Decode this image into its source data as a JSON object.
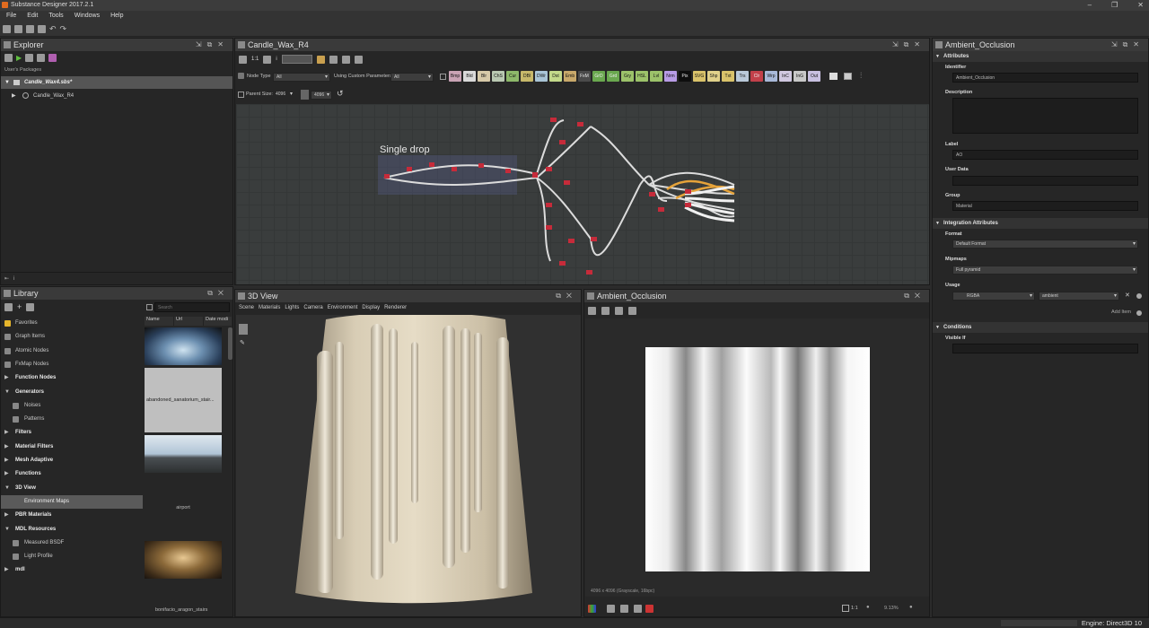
{
  "app": {
    "title": "Substance Designer 2017.2.1"
  },
  "menu": [
    "File",
    "Edit",
    "Tools",
    "Windows",
    "Help"
  ],
  "explorer": {
    "title": "Explorer",
    "section_label": "User's Packages",
    "package": "Candle_Wax4.sbs*",
    "graph": "Candle_Wax_R4"
  },
  "library": {
    "title": "Library",
    "search_placeholder": "Search",
    "columns": [
      "Name",
      "Url",
      "Date modi"
    ],
    "categories": [
      {
        "label": "Favorites",
        "bold": false,
        "type": "icon"
      },
      {
        "label": "Graph Items",
        "bold": false,
        "type": "icon"
      },
      {
        "label": "Atomic Nodes",
        "bold": false,
        "type": "icon"
      },
      {
        "label": "FxMap Nodes",
        "bold": false,
        "type": "icon"
      },
      {
        "label": "Function Nodes",
        "bold": true,
        "type": "collapsed"
      },
      {
        "label": "Generators",
        "bold": true,
        "type": "expanded"
      },
      {
        "label": "Noises",
        "bold": false,
        "type": "child"
      },
      {
        "label": "Patterns",
        "bold": false,
        "type": "child"
      },
      {
        "label": "Filters",
        "bold": true,
        "type": "collapsed"
      },
      {
        "label": "Material Filters",
        "bold": true,
        "type": "collapsed"
      },
      {
        "label": "Mesh Adaptive",
        "bold": true,
        "type": "collapsed"
      },
      {
        "label": "Functions",
        "bold": true,
        "type": "collapsed"
      },
      {
        "label": "3D View",
        "bold": true,
        "type": "expanded"
      },
      {
        "label": "Environment Maps",
        "bold": false,
        "type": "selected"
      },
      {
        "label": "PBR Materials",
        "bold": true,
        "type": "collapsed"
      },
      {
        "label": "MDL Resources",
        "bold": true,
        "type": "expanded"
      },
      {
        "label": "Measured BSDF",
        "bold": false,
        "type": "child"
      },
      {
        "label": "Light Profile",
        "bold": false,
        "type": "child"
      },
      {
        "label": "mdl",
        "bold": true,
        "type": "collapsed"
      }
    ],
    "thumbnails": [
      "abandoned_sanatorium_stair...",
      "airport",
      "bonifacio_aragon_stairs"
    ]
  },
  "graph": {
    "title": "Candle_Wax_R4",
    "zoom_label": "1:1",
    "node_type_label": "Node Type",
    "node_type_value": "All",
    "custom_params_label": "Using Custom Parameters",
    "custom_params_value": "All",
    "parent_size_label": "Parent Size:",
    "size_w": "4096",
    "size_h": "4096",
    "frame_label": "Single drop",
    "node_buttons": [
      {
        "label": "Bmp",
        "color": "#c9a3b5"
      },
      {
        "label": "Bld",
        "color": "#d9d9d9"
      },
      {
        "label": "Blr",
        "color": "#d6c9a8"
      },
      {
        "label": "ChS",
        "color": "#b9c9b2"
      },
      {
        "label": "Cur",
        "color": "#8db86a"
      },
      {
        "label": "DBl",
        "color": "#c7b86a"
      },
      {
        "label": "DWr",
        "color": "#a9c4d6"
      },
      {
        "label": "Dst",
        "color": "#c3d98a"
      },
      {
        "label": "Emb",
        "color": "#c8a86a"
      },
      {
        "label": "FxM",
        "color": "#4a4a4a"
      },
      {
        "label": "GrD",
        "color": "#6aa84f"
      },
      {
        "label": "Grd",
        "color": "#6aa84f"
      },
      {
        "label": "Gry",
        "color": "#9cc26a"
      },
      {
        "label": "HSL",
        "color": "#9cc26a"
      },
      {
        "label": "Lvl",
        "color": "#9cc26a"
      },
      {
        "label": "Nrm",
        "color": "#b89ce6"
      },
      {
        "label": "Pix",
        "color": "#0e0e0e"
      },
      {
        "label": "SVG",
        "color": "#d9c26a"
      },
      {
        "label": "Shp",
        "color": "#e0d08a"
      },
      {
        "label": "Txt",
        "color": "#d9c26a"
      },
      {
        "label": "Trs",
        "color": "#b9c9d9"
      },
      {
        "label": "Clr",
        "color": "#c2404a"
      },
      {
        "label": "Wrp",
        "color": "#a8b8d8"
      },
      {
        "label": "InC",
        "color": "#d0c8e0"
      },
      {
        "label": "InG",
        "color": "#c8c8c8"
      },
      {
        "label": "Out",
        "color": "#c8c0e0"
      }
    ]
  },
  "view3d": {
    "title": "3D View",
    "menu": [
      "Scene",
      "Materials",
      "Lights",
      "Camera",
      "Environment",
      "Display",
      "Renderer"
    ]
  },
  "view2d": {
    "title": "Ambient_Occlusion",
    "info": "4096 x 4096 (Grayscale, 16bpc)",
    "zoom_ratio": "1:1",
    "zoom_percent": "9.13%"
  },
  "properties": {
    "title": "Ambient_Occlusion",
    "attributes_section": "Attributes",
    "identifier_label": "Identifier",
    "identifier_value": "Ambient_Occlusion",
    "description_label": "Description",
    "label_label": "Label",
    "label_value": "AO",
    "user_data_label": "User Data",
    "group_label": "Group",
    "group_value": "Material",
    "integration_section": "Integration Attributes",
    "format_label": "Format",
    "format_value": "Default Format",
    "mipmaps_label": "Mipmaps",
    "mipmaps_value": "Full pyramid",
    "usage_label": "Usage",
    "usage_channel": "RGBA",
    "usage_value": "ambient",
    "add_item": "Add Item",
    "conditions_section": "Conditions",
    "visible_if_label": "Visible If"
  },
  "status": {
    "engine": "Engine: Direct3D 10"
  }
}
